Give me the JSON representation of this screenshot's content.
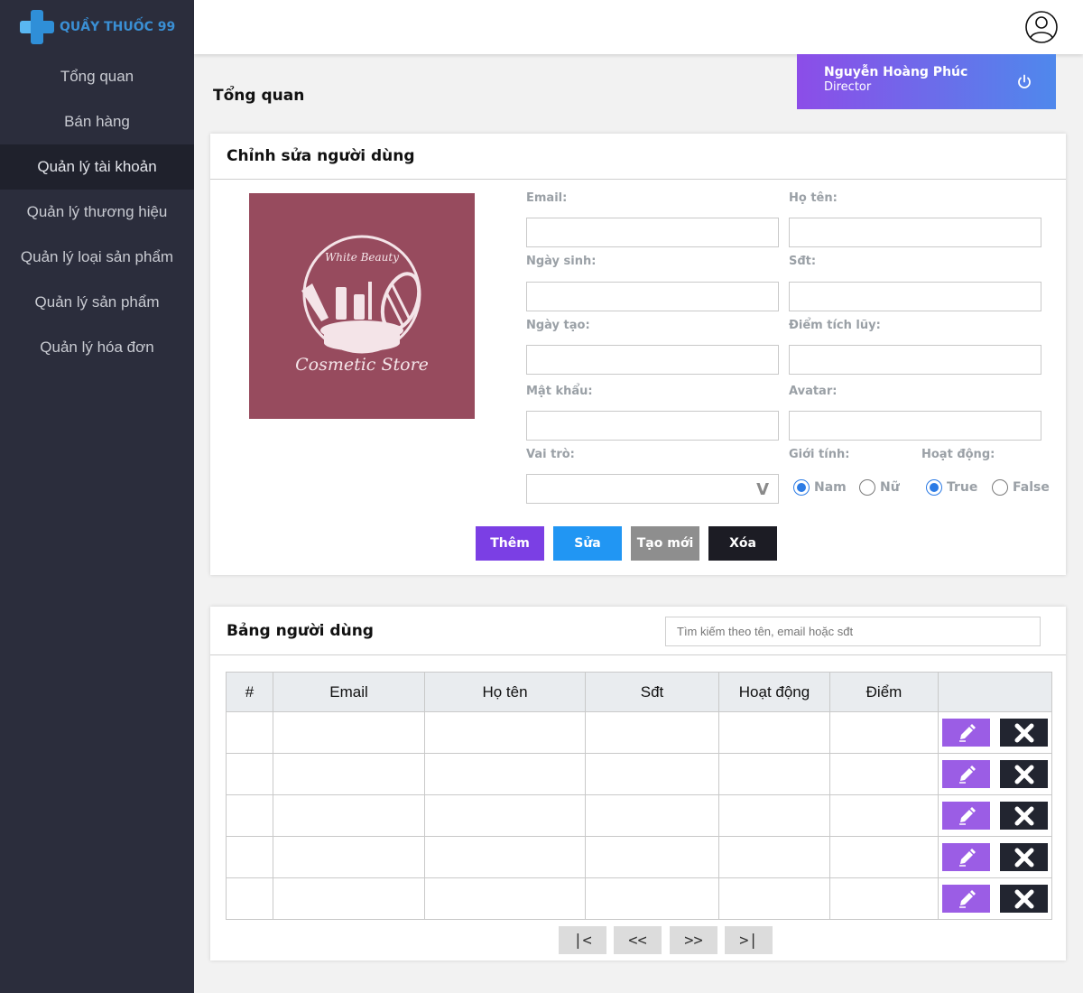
{
  "app": {
    "brand": "QUẦY THUỐC 99"
  },
  "sidebar": {
    "items": [
      {
        "label": "Tổng quan",
        "active": false
      },
      {
        "label": "Bán hàng",
        "active": false
      },
      {
        "label": "Quản lý tài khoản",
        "active": true
      },
      {
        "label": "Quản lý thương hiệu",
        "active": false
      },
      {
        "label": "Quản lý loại sản phẩm",
        "active": false
      },
      {
        "label": "Quản lý sản phẩm",
        "active": false
      },
      {
        "label": "Quản lý hóa đơn",
        "active": false
      }
    ]
  },
  "header": {
    "icon": "user-circle-icon"
  },
  "page": {
    "title": "Tổng quan"
  },
  "user_card": {
    "name": "Nguyễn Hoàng Phúc",
    "role": "Director",
    "icon": "power-icon"
  },
  "edit_form": {
    "title": "Chỉnh sửa người dùng",
    "image": {
      "line1": "White Beauty",
      "line2": "Cosmetic Store"
    },
    "labels": {
      "email": "Email:",
      "fullname": "Họ tên:",
      "birthday": "Ngày sinh:",
      "phone": "Sđt:",
      "created": "Ngày tạo:",
      "points": "Điểm tích lũy:",
      "password": "Mật khẩu:",
      "avatar": "Avatar:",
      "role": "Vai trò:",
      "gender": "Giới tính:",
      "active": "Hoạt động:"
    },
    "values": {
      "email": "",
      "fullname": "",
      "birthday": "",
      "phone": "",
      "created": "",
      "points": "",
      "password": "",
      "avatar": "",
      "role": ""
    },
    "select_chevron": "V",
    "gender_options": [
      {
        "label": "Nam",
        "checked": true
      },
      {
        "label": "Nữ",
        "checked": false
      }
    ],
    "active_options": [
      {
        "label": "True",
        "checked": true
      },
      {
        "label": "False",
        "checked": false
      }
    ],
    "buttons": {
      "add": "Thêm",
      "edit": "Sửa",
      "new": "Tạo mới",
      "delete": "Xóa"
    },
    "colors": {
      "add": "#7b3fe4",
      "edit": "#2196f3",
      "new": "#8e8e8e",
      "delete": "#1c1c24"
    }
  },
  "user_table": {
    "title": "Bảng người dùng",
    "search_placeholder": "Tìm kiếm theo tên, email hoặc sđt",
    "columns": [
      "#",
      "Email",
      "Họ tên",
      "Sđt",
      "Hoạt động",
      "Điểm",
      ""
    ],
    "rows": [
      [
        "",
        "",
        "",
        "",
        "",
        ""
      ],
      [
        "",
        "",
        "",
        "",
        "",
        ""
      ],
      [
        "",
        "",
        "",
        "",
        "",
        ""
      ],
      [
        "",
        "",
        "",
        "",
        "",
        ""
      ],
      [
        "",
        "",
        "",
        "",
        "",
        ""
      ]
    ],
    "row_actions": {
      "edit_icon": "pencil-icon",
      "delete_icon": "close-x-icon",
      "edit_color": "#9b5de5",
      "delete_color": "#222530"
    },
    "pager": {
      "first": "|<",
      "prev": "<<",
      "next": ">>",
      "last": ">|"
    }
  }
}
